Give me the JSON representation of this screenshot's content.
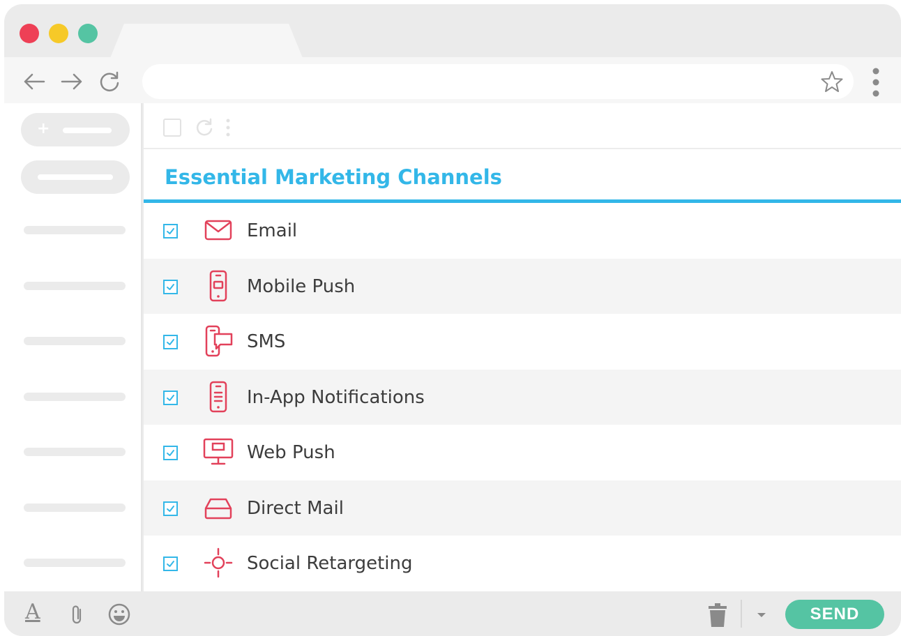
{
  "window": {
    "colors": {
      "close": "#ee4056",
      "minimize": "#f6c928",
      "maximize": "#55c4a3"
    }
  },
  "toolbar": {
    "icons": [
      "back-arrow-icon",
      "forward-arrow-icon",
      "reload-icon",
      "star-icon",
      "more-vertical-icon"
    ],
    "address_value": ""
  },
  "email": {
    "title": "Essential Marketing Channels",
    "accent": "#33b7e8",
    "icon_color": "#e2415a",
    "channels": [
      {
        "label": "Email",
        "icon": "envelope-icon",
        "checked": true
      },
      {
        "label": "Mobile Push",
        "icon": "mobile-phone-icon",
        "checked": true
      },
      {
        "label": "SMS",
        "icon": "phone-message-icon",
        "checked": true
      },
      {
        "label": "In-App Notifications",
        "icon": "phone-notification-icon",
        "checked": true
      },
      {
        "label": "Web Push",
        "icon": "desktop-monitor-icon",
        "checked": true
      },
      {
        "label": "Direct Mail",
        "icon": "mailbox-tray-icon",
        "checked": true
      },
      {
        "label": "Social Retargeting",
        "icon": "target-crosshair-icon",
        "checked": true
      }
    ]
  },
  "footer": {
    "send_label": "SEND",
    "send_color": "#55c4a3",
    "text_format_glyph": "A"
  }
}
